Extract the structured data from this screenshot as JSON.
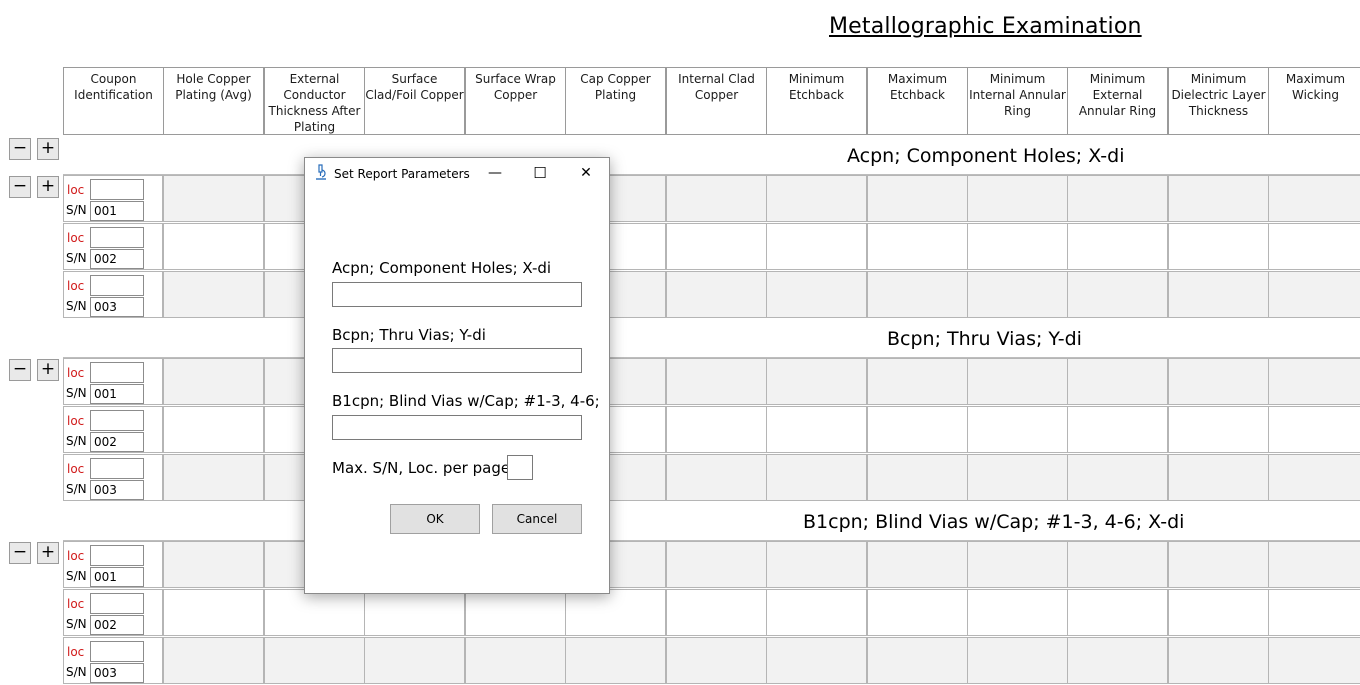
{
  "page": {
    "title": "Metallographic Examination"
  },
  "columns": [
    "Coupon Identification",
    "Hole Copper Plating (Avg)",
    "External Conductor Thickness After Plating",
    "Surface Clad/Foil Copper",
    "Surface Wrap Copper",
    "Cap Copper Plating",
    "Internal Clad Copper",
    "Minimum Etchback",
    "Maximum Etchback",
    "Minimum Internal Annular Ring",
    "Minimum External Annular Ring",
    "Minimum Dielectric Layer Thickness",
    "Maximum Wicking"
  ],
  "controls": {
    "minus": "−",
    "plus": "+"
  },
  "row_labels": {
    "loc": "loc",
    "sn": "S/N"
  },
  "groups": [
    {
      "label": "Acpn; Component Holes; X-di",
      "rows": [
        {
          "sn": "001"
        },
        {
          "sn": "002"
        },
        {
          "sn": "003"
        }
      ]
    },
    {
      "label": "Bcpn; Thru Vias; Y-di",
      "rows": [
        {
          "sn": "001"
        },
        {
          "sn": "002"
        },
        {
          "sn": "003"
        }
      ]
    },
    {
      "label": "B1cpn; Blind Vias w/Cap; #1-3, 4-6; X-di",
      "rows": [
        {
          "sn": "001"
        },
        {
          "sn": "002"
        },
        {
          "sn": "003"
        }
      ]
    }
  ],
  "dialog": {
    "title": "Set Report Parameters",
    "minimize": "—",
    "maximize": "☐",
    "close": "✕",
    "field1_label": "Acpn; Component Holes; X-di",
    "field1_value": "",
    "field2_label": "Bcpn; Thru Vias; Y-di",
    "field2_value": "",
    "field3_label": "B1cpn; Blind Vias w/Cap; #1-3, 4-6;",
    "field3_value": "",
    "max_label": "Max. S/N, Loc. per page",
    "max_value": "",
    "ok": "OK",
    "cancel": "Cancel"
  }
}
